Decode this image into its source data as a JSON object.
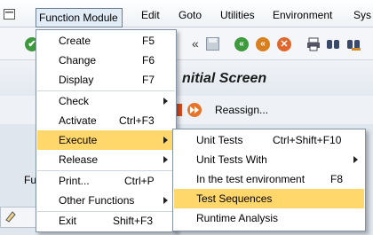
{
  "menubar": {
    "items": [
      "Function Module",
      "Edit",
      "Goto",
      "Utilities",
      "Environment",
      "Sys"
    ]
  },
  "app": {
    "title": "nitial Screen",
    "reassign_label": "Reassign...",
    "background_label": "Fu"
  },
  "function_menu": {
    "items": [
      {
        "label": "Create",
        "shortcut": "F5"
      },
      {
        "label": "Change",
        "shortcut": "F6"
      },
      {
        "label": "Display",
        "shortcut": "F7"
      },
      {
        "label": "Check",
        "shortcut": ""
      },
      {
        "label": "Activate",
        "shortcut": "Ctrl+F3"
      },
      {
        "label": "Execute",
        "shortcut": ""
      },
      {
        "label": "Release",
        "shortcut": ""
      },
      {
        "label": "Print...",
        "shortcut": "Ctrl+P"
      },
      {
        "label": "Other Functions",
        "shortcut": ""
      },
      {
        "label": "Exit",
        "shortcut": "Shift+F3"
      }
    ]
  },
  "execute_submenu": {
    "items": [
      {
        "label": "Unit Tests",
        "shortcut": "Ctrl+Shift+F10"
      },
      {
        "label": "Unit Tests With",
        "shortcut": ""
      },
      {
        "label": "In the test environment",
        "shortcut": "F8"
      },
      {
        "label": "Test Sequences",
        "shortcut": ""
      },
      {
        "label": "Runtime Analysis",
        "shortcut": ""
      }
    ]
  },
  "colors": {
    "highlight": "#ffd76b",
    "menu_border": "#8393a5",
    "green_icon": "#3d9a3d",
    "orange_icon": "#e0662c"
  }
}
